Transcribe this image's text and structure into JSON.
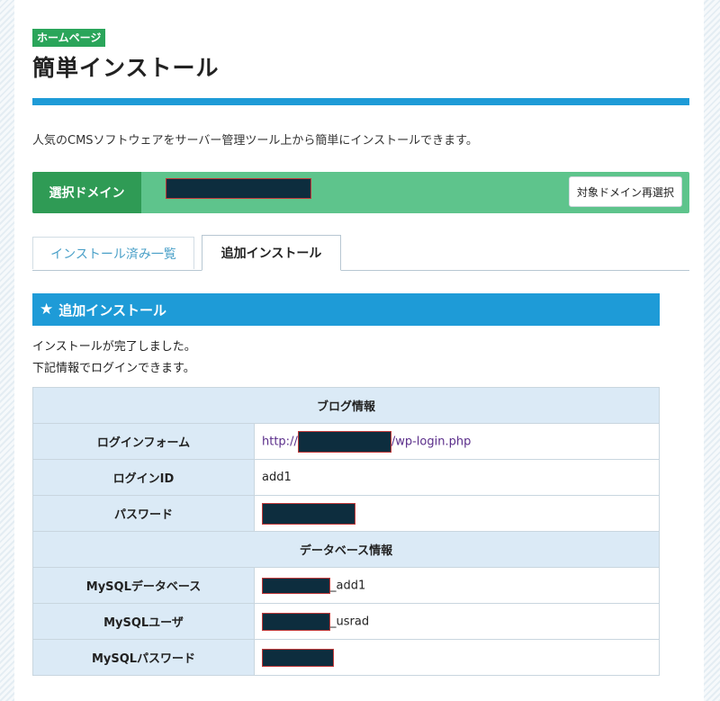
{
  "header": {
    "badge": "ホームページ",
    "title": "簡単インストール",
    "intro": "人気のCMSソフトウェアをサーバー管理ツール上から簡単にインストールできます。"
  },
  "domain": {
    "label": "選択ドメイン",
    "reselect_label": "対象ドメイン再選択"
  },
  "tabs": [
    {
      "label": "インストール済み一覧"
    },
    {
      "label": "追加インストール"
    }
  ],
  "section": {
    "title": "追加インストール",
    "message1": "インストールが完了しました。",
    "message2": "下記情報でログインできます。"
  },
  "blog_info": {
    "heading": "ブログ情報",
    "login_form_label": "ログインフォーム",
    "login_form_prefix": "http://",
    "login_form_suffix": "/wp-login.php",
    "login_id_label": "ログインID",
    "login_id_value": "add1",
    "password_label": "パスワード"
  },
  "db_info": {
    "heading": "データベース情報",
    "db_label": "MySQLデータベース",
    "db_suffix": "_add1",
    "user_label": "MySQLユーザ",
    "user_suffix": "_usrad",
    "password_label": "MySQLパスワード"
  },
  "colors": {
    "accent_blue": "#1e9bd7",
    "badge_green": "#2aa55a",
    "domain_bar": "#5ec48c",
    "header_cell": "#dbeaf6"
  }
}
